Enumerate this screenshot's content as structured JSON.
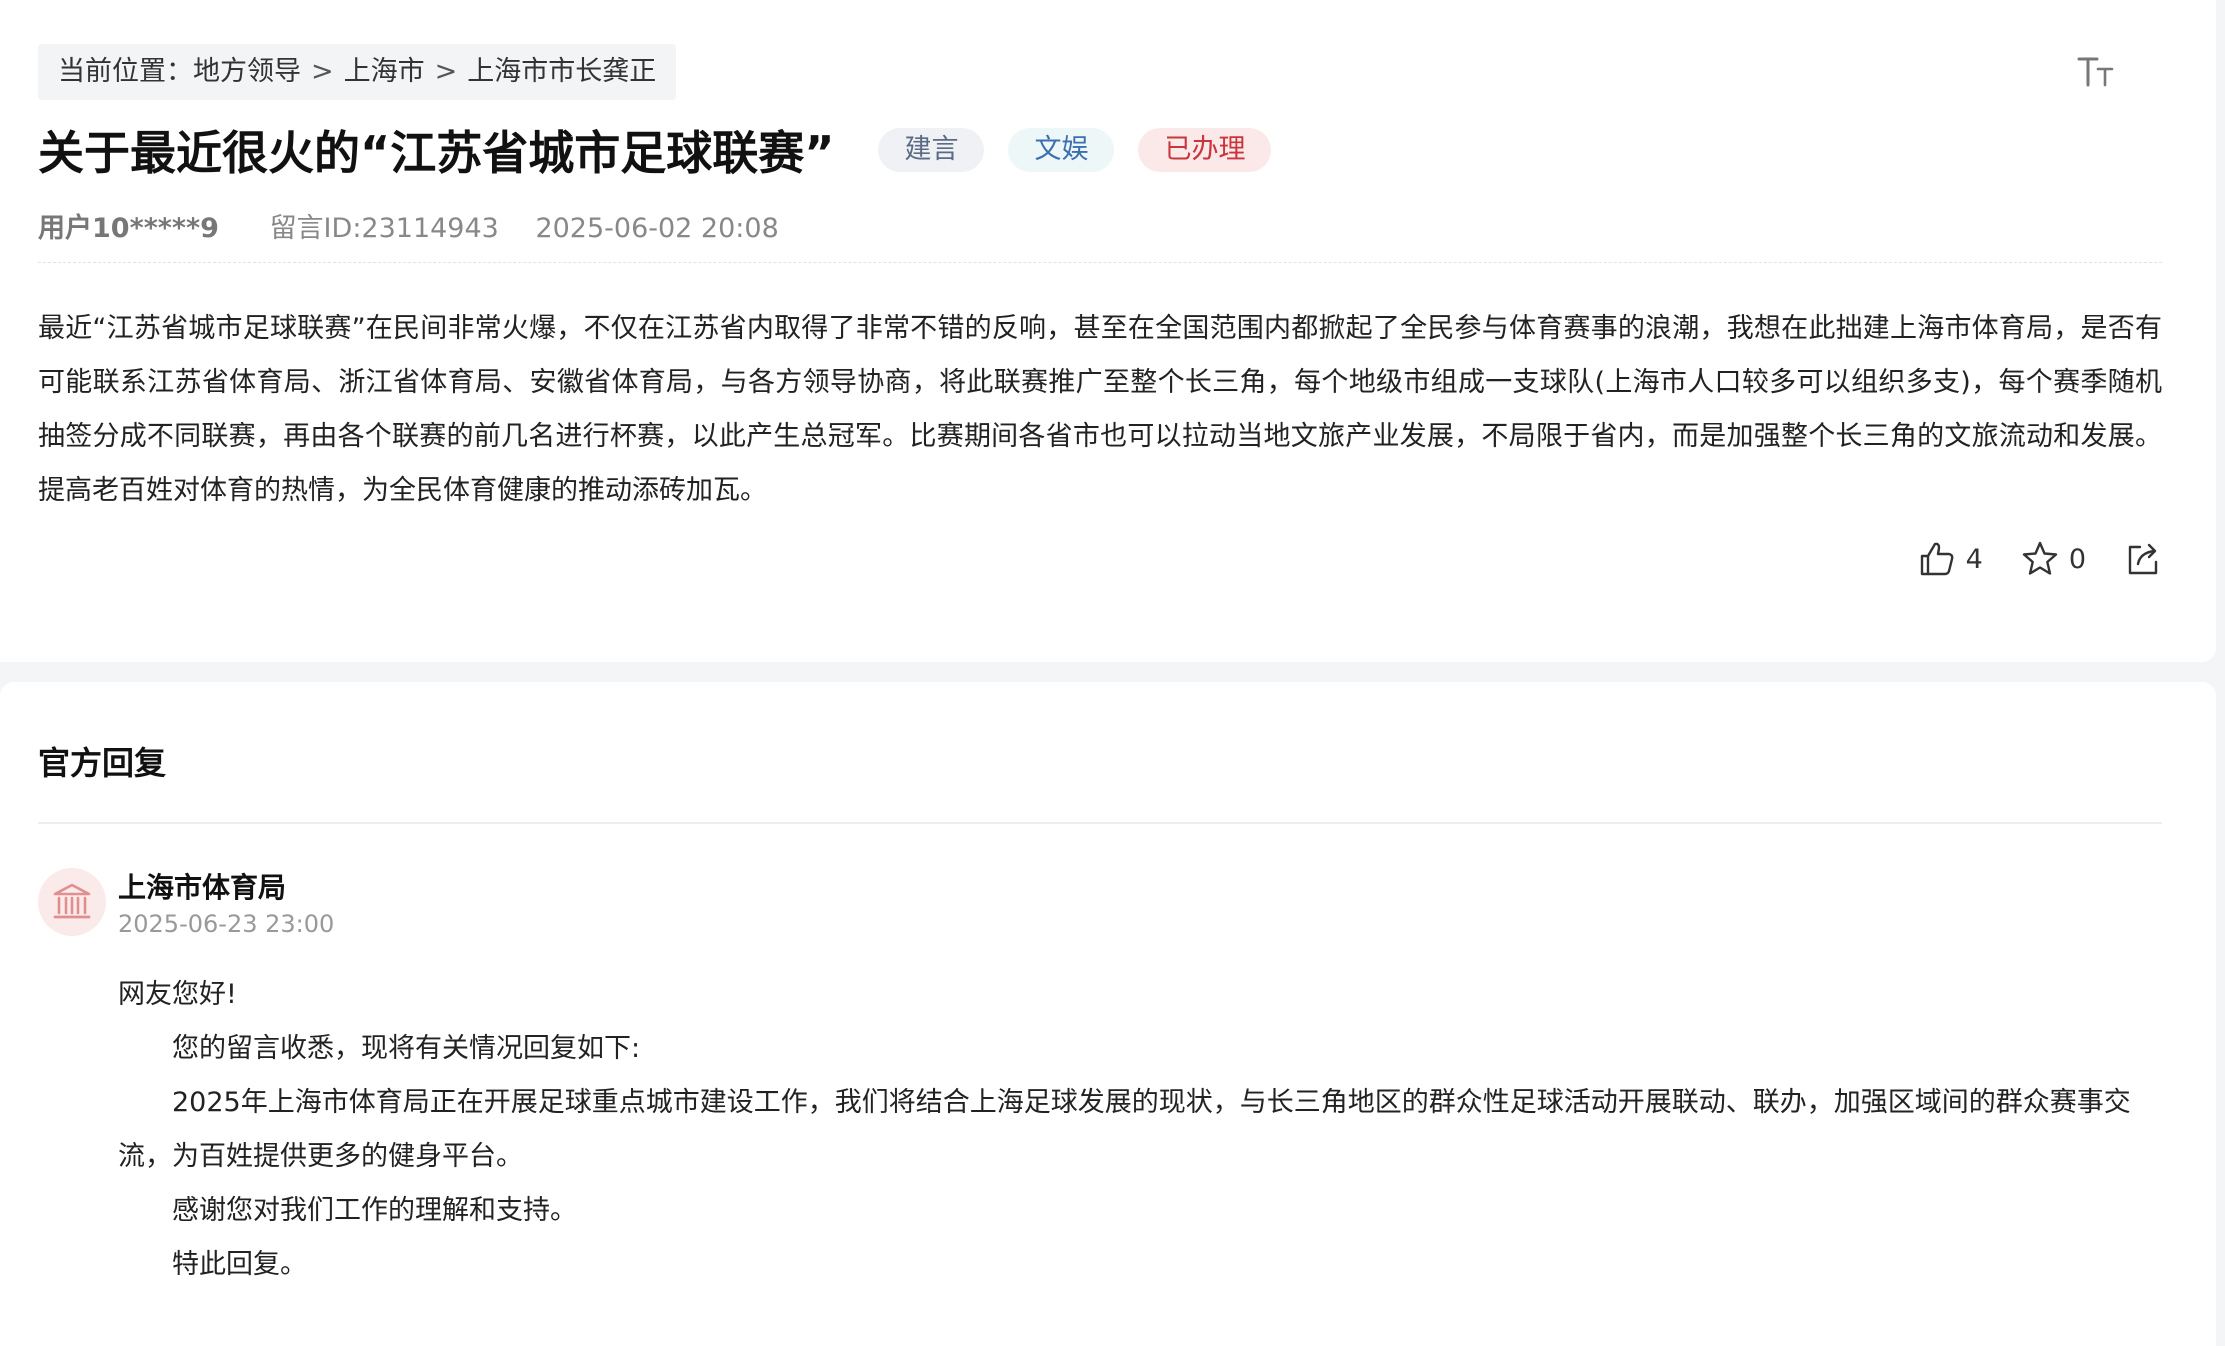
{
  "breadcrumb": {
    "prefix": "当前位置：",
    "items": [
      "地方领导",
      "上海市",
      "上海市市长龚正"
    ],
    "separator": ">"
  },
  "post": {
    "title": "关于最近很火的“江苏省城市足球联赛”",
    "tags": [
      "建言",
      "文娱",
      "已办理"
    ],
    "user": "用户10*****9",
    "message_id": "留言ID:23114943",
    "datetime": "2025-06-02 20:08",
    "content": "最近“江苏省城市足球联赛”在民间非常火爆，不仅在江苏省内取得了非常不错的反响，甚至在全国范围内都掀起了全民参与体育赛事的浪潮，我想在此拙建上海市体育局，是否有可能联系江苏省体育局、浙江省体育局、安徽省体育局，与各方领导协商，将此联赛推广至整个长三角，每个地级市组成一支球队(上海市人口较多可以组织多支)，每个赛季随机抽签分成不同联赛，再由各个联赛的前几名进行杯赛，以此产生总冠军。比赛期间各省市也可以拉动当地文旅产业发展，不局限于省内，而是加强整个长三角的文旅流动和发展。提高老百姓对体育的热情，为全民体育健康的推动添砖加瓦。",
    "likes": "4",
    "favorites": "0"
  },
  "reply": {
    "section_title": "官方回复",
    "department": "上海市体育局",
    "datetime": "2025-06-23 23:00",
    "greeting": "网友您好!",
    "paragraphs": [
      "您的留言收悉，现将有关情况回复如下:",
      "2025年上海市体育局正在开展足球重点城市建设工作，我们将结合上海足球发展的现状，与长三角地区的群众性足球活动开展联动、联办，加强区域间的群众赛事交流，为百姓提供更多的健身平台。",
      "感谢您对我们工作的理解和支持。",
      "特此回复。"
    ]
  },
  "colors": {
    "tag_done": "#c9353b",
    "tag_entertainment": "#3c6fb0",
    "tag_suggest": "#5b6a85"
  }
}
